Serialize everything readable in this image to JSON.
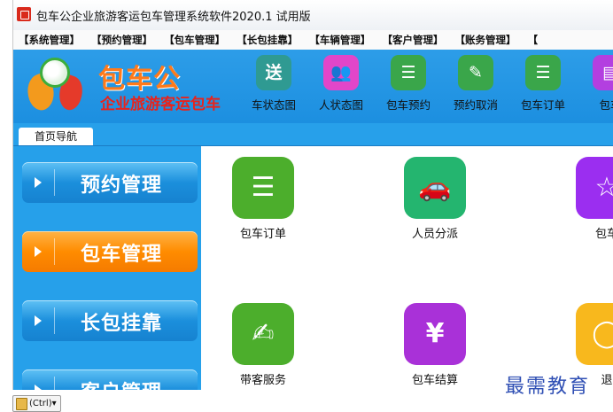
{
  "window": {
    "title": "包车公企业旅游客运包车管理系统软件2020.1 试用版"
  },
  "menu": [
    "【系统管理】",
    "【预约管理】",
    "【包车管理】",
    "【长包挂靠】",
    "【车辆管理】",
    "【客户管理】",
    "【账务管理】",
    "【"
  ],
  "logo": {
    "name": "包车公",
    "slogan": "企业旅游客运包车"
  },
  "toolbar": [
    {
      "label": "车状态图",
      "icon": "delivery-truck-icon",
      "glyph": "送",
      "color": "#2f9a92"
    },
    {
      "label": "人状态图",
      "icon": "people-icon",
      "glyph": "👥",
      "color": "#e246c9"
    },
    {
      "label": "包车预约",
      "icon": "clipboard-check-icon",
      "glyph": "☰",
      "color": "#3aa64a"
    },
    {
      "label": "预约取消",
      "icon": "edit-square-icon",
      "glyph": "✎",
      "color": "#3aa64a"
    },
    {
      "label": "包车订单",
      "icon": "order-cart-icon",
      "glyph": "☰",
      "color": "#3aa64a"
    },
    {
      "label": "包车",
      "icon": "document-icon",
      "glyph": "▤",
      "color": "#b33fe0"
    }
  ],
  "nav": {
    "tab": "首页导航"
  },
  "sidebar": [
    {
      "label": "预约管理",
      "style": "blue"
    },
    {
      "label": "包车管理",
      "style": "orange"
    },
    {
      "label": "长包挂靠",
      "style": "blue"
    },
    {
      "label": "客户管理",
      "style": "blue"
    }
  ],
  "cards": [
    {
      "label": "包车订单",
      "icon": "order-cart-icon",
      "glyph": "☰",
      "color": "#4cae2c"
    },
    {
      "label": "人员分派",
      "icon": "car-dispatch-icon",
      "glyph": "🚗",
      "color": "#24b56f"
    },
    {
      "label": "包车",
      "icon": "star-document-icon",
      "glyph": "☆",
      "color": "#9b2ef0"
    },
    {
      "label": "带客服务",
      "icon": "pen-paper-icon",
      "glyph": "✍",
      "color": "#4cae2c"
    },
    {
      "label": "包车结算",
      "icon": "invoice-yen-icon",
      "glyph": "¥",
      "color": "#a931d8"
    },
    {
      "label": "退",
      "icon": "coin-icon",
      "glyph": "◯",
      "color": "#f8b81d"
    }
  ],
  "watermark": "最需教育",
  "paste_button": "(Ctrl)▾"
}
